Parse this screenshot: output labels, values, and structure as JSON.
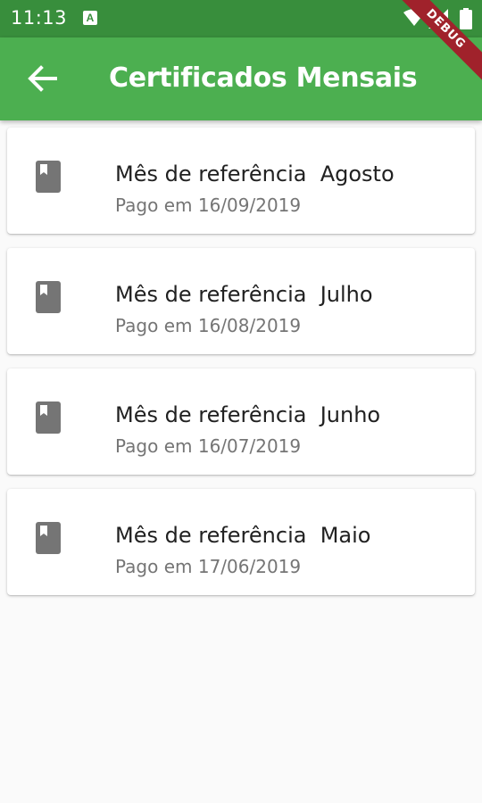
{
  "status_bar": {
    "time": "11:13",
    "notification_letter": "A"
  },
  "app_bar": {
    "title": "Certificados Mensais",
    "back_icon": "arrow-back-icon",
    "color": "#4caf50",
    "status_color": "#388e3c"
  },
  "debug_banner": {
    "label": "DEBUG",
    "color": "#a0222b"
  },
  "certificates": [
    {
      "title": "Mês de referência  Agosto",
      "subtitle": "Pago em 16/09/2019",
      "icon": "book-icon"
    },
    {
      "title": "Mês de referência  Julho",
      "subtitle": "Pago em 16/08/2019",
      "icon": "book-icon"
    },
    {
      "title": "Mês de referência  Junho",
      "subtitle": "Pago em 16/07/2019",
      "icon": "book-icon"
    },
    {
      "title": "Mês de referência  Maio",
      "subtitle": "Pago em 17/06/2019",
      "icon": "book-icon"
    }
  ]
}
